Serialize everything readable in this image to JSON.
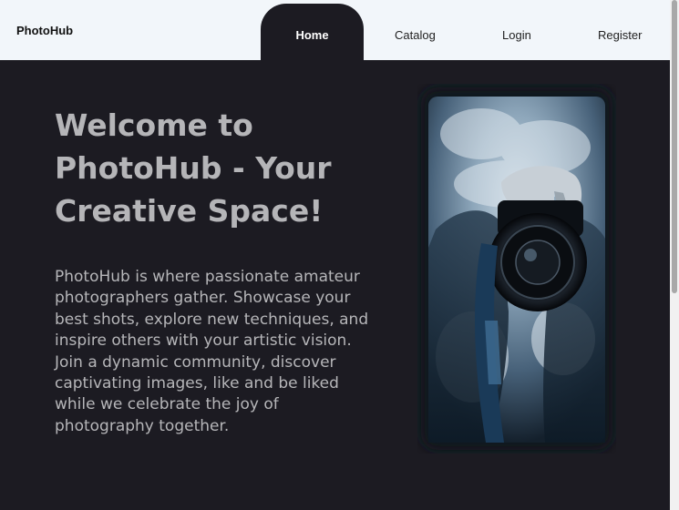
{
  "header": {
    "brand": "PhotoHub",
    "nav": {
      "home": "Home",
      "catalog": "Catalog",
      "login": "Login",
      "register": "Register"
    }
  },
  "hero": {
    "title": "Welcome to PhotoHub - Your Creative Space!",
    "description": "PhotoHub is where passionate amateur photographers gather. Showcase your best shots, explore new techniques, and inspire others with your artistic vision. Join a dynamic community, discover captivating images, like and be liked while we celebrate the joy of photography together.",
    "image": "photographer-with-camera-in-smoke"
  },
  "colors": {
    "background": "#1c1b22",
    "header": "#f2f6fa",
    "text": "#b5b5b8"
  }
}
